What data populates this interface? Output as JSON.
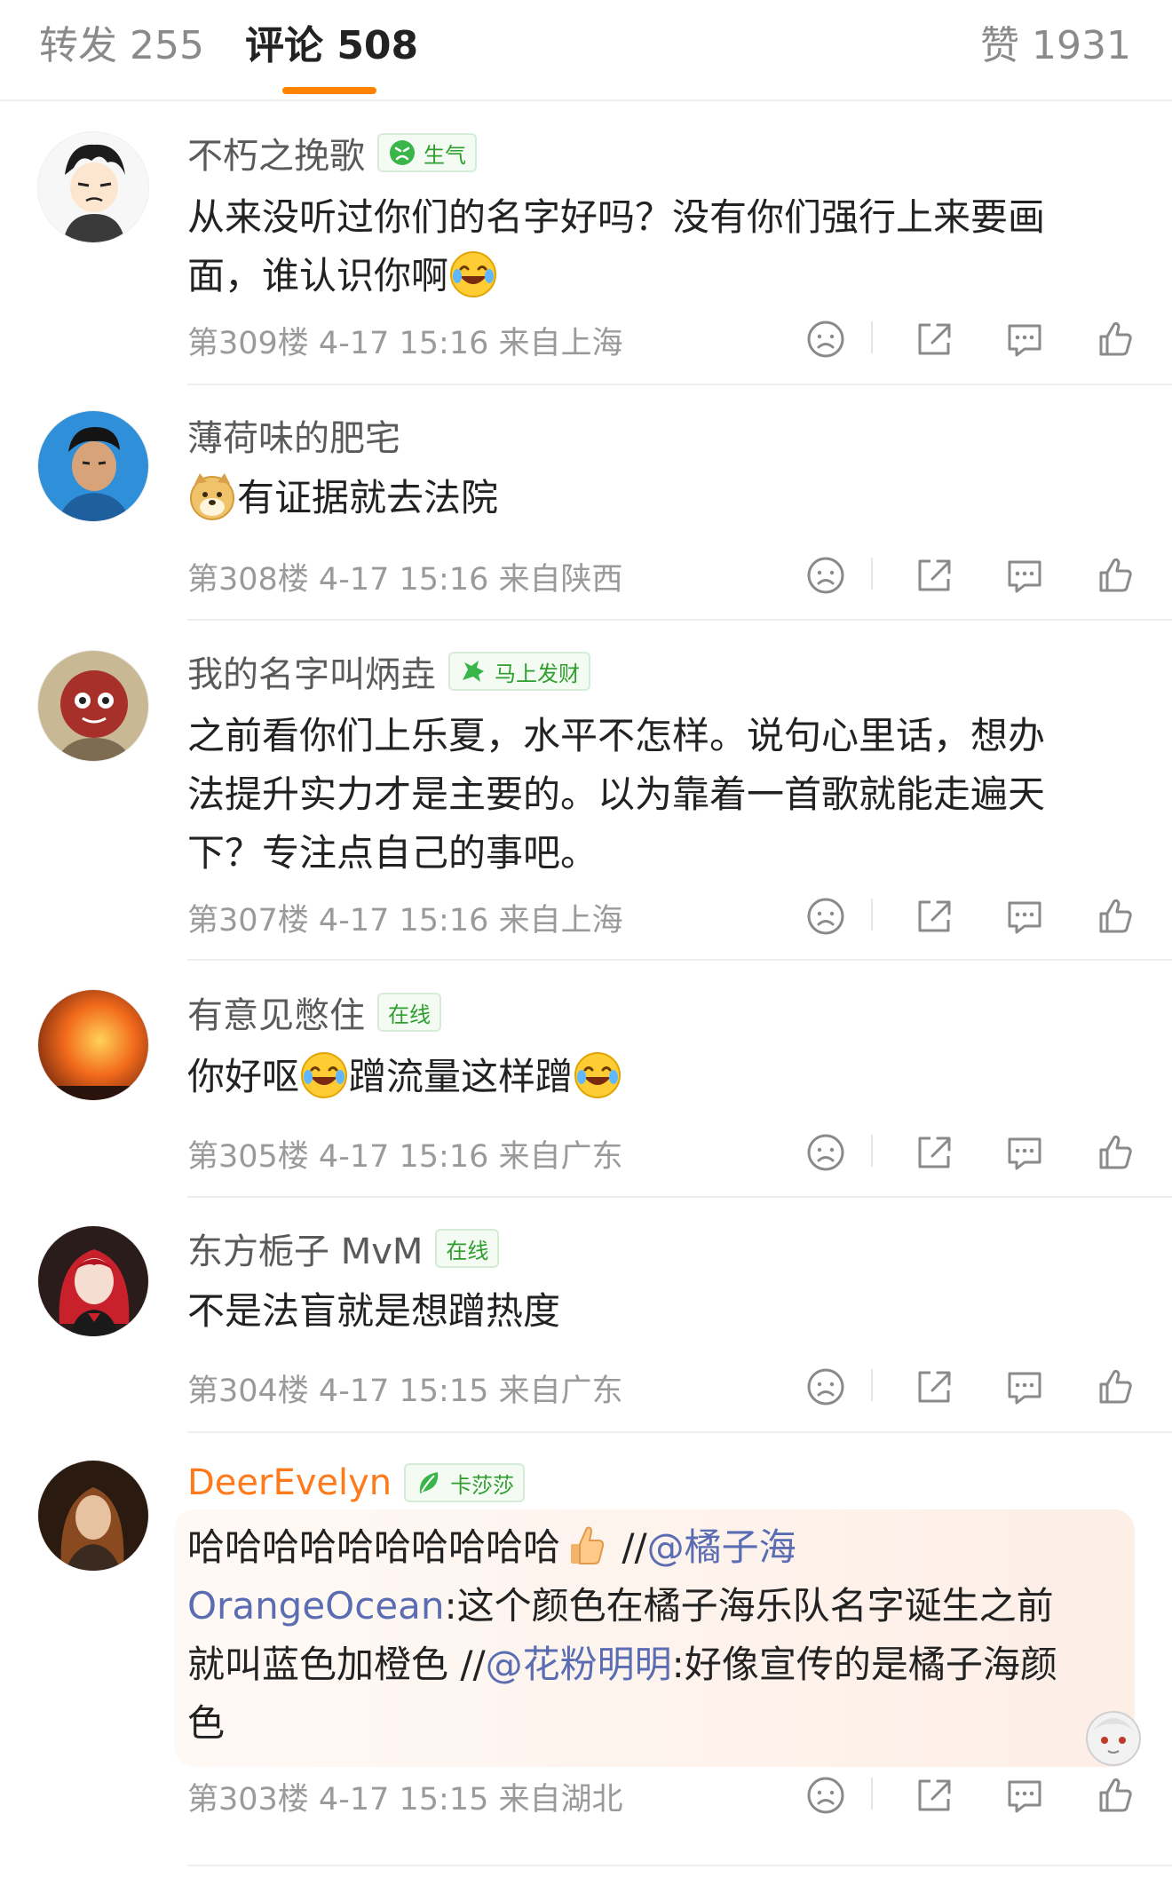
{
  "tabs": {
    "reposts": "转发 255",
    "comments": "评论 508",
    "likes": "赞 1931"
  },
  "colors": {
    "accent": "#ff8200",
    "link": "#5a6db3",
    "badge_green": "#2e9e2e",
    "vip_name": "#ff7a1a"
  },
  "comments": [
    {
      "username": "不朽之挽歌",
      "badge": "生气",
      "badge_icon": "angry-face-icon",
      "text_line1": "从来没听过你们的名字好吗？没有你们强行上来要画",
      "text_line2": "面，谁认识你啊",
      "emoji": "laughing-crying-emoji",
      "meta": "第309楼 4-17 15:16 来自上海"
    },
    {
      "username": "薄荷味的肥宅",
      "emoji": "doge-emoji",
      "text": "有证据就去法院",
      "meta": "第308楼 4-17 15:16 来自陕西"
    },
    {
      "username": "我的名字叫炳垚",
      "badge": "马上发财",
      "badge_icon": "horse-icon",
      "text_line1": "之前看你们上乐夏，水平不怎样。说句心里话，想办",
      "text_line2": "法提升实力才是主要的。以为靠着一首歌就能走遍天",
      "text_line3": "下？专注点自己的事吧。",
      "meta": "第307楼 4-17 15:16 来自上海"
    },
    {
      "username": "有意见憋住",
      "badge": "在线",
      "text_part1": "你好呕",
      "text_part2": "蹭流量这样蹭",
      "emoji": "laughing-crying-emoji",
      "meta": "第305楼 4-17 15:16 来自广东"
    },
    {
      "username": "东方栀子 MvM",
      "badge": "在线",
      "text": "不是法盲就是想蹭热度",
      "meta": "第304楼 4-17 15:15 来自广东"
    },
    {
      "username": "DeerEvelyn",
      "badge": "卡莎莎",
      "badge_icon": "leaf-icon",
      "text_part1": "哈哈哈哈哈哈哈哈哈哈",
      "emoji": "thumbs-up-emoji",
      "slashes1": " //",
      "mention1": "@橘子海",
      "mention1b": "OrangeOcean",
      "text_part2": ":这个颜色在橘子海乐队名字诞生之前",
      "text_part3": "就叫蓝色加橙色 //",
      "mention2": "@花粉明明",
      "text_part4": ":好像宣传的是橘子海颜",
      "text_part5": "色",
      "meta": "第303楼 4-17 15:15 来自湖北"
    }
  ],
  "action_icons": [
    "sad-face-icon",
    "share-icon",
    "comment-icon",
    "thumbs-up-icon"
  ]
}
